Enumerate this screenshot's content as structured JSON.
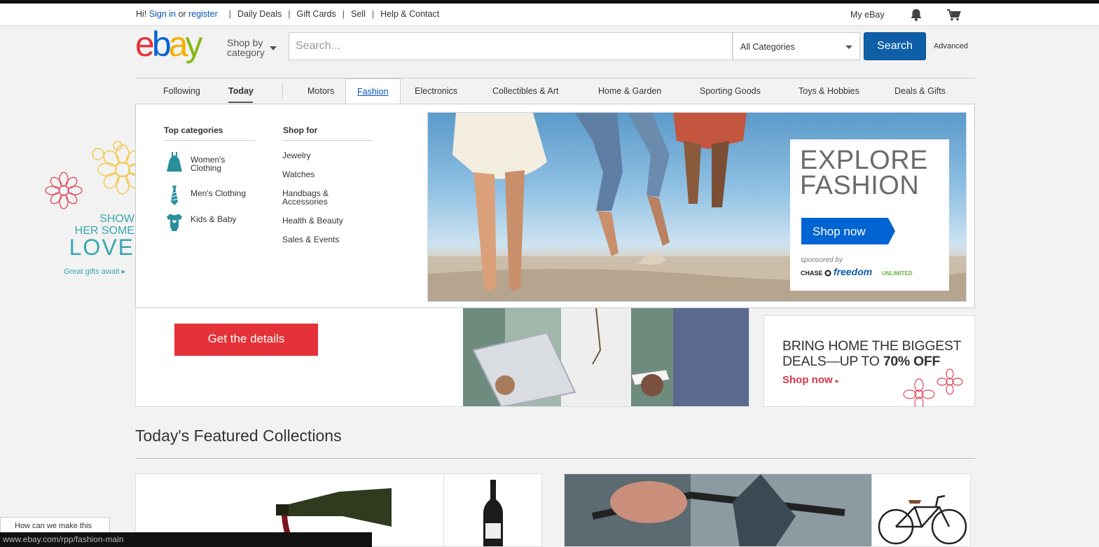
{
  "utility": {
    "greeting": "Hi!",
    "sign_in": "Sign in",
    "or": "or",
    "register": "register",
    "links": [
      "Daily Deals",
      "Gift Cards",
      "Sell",
      "Help & Contact"
    ],
    "my_ebay": "My eBay"
  },
  "header": {
    "shop_by_line1": "Shop by",
    "shop_by_line2": "category",
    "search_placeholder": "Search...",
    "category_selected": "All Categories",
    "search_button": "Search",
    "advanced": "Advanced"
  },
  "nav": {
    "items": [
      "Following",
      "Today",
      "Motors",
      "Fashion",
      "Electronics",
      "Collectibles & Art",
      "Home & Garden",
      "Sporting Goods",
      "Toys & Hobbies",
      "Deals & Gifts"
    ]
  },
  "dropdown": {
    "top_categories_heading": "Top categories",
    "top_categories": [
      {
        "line1": "Women's",
        "line2": "Clothing",
        "icon": "dress-icon"
      },
      {
        "line1": "Men's Clothing",
        "line2": "",
        "icon": "tie-icon"
      },
      {
        "line1": "Kids & Baby",
        "line2": "",
        "icon": "onesie-icon"
      }
    ],
    "shop_for_heading": "Shop for",
    "shop_for": [
      {
        "line1": "Jewelry",
        "line2": ""
      },
      {
        "line1": "Watches",
        "line2": ""
      },
      {
        "line1": "Handbags &",
        "line2": "Accessories"
      },
      {
        "line1": "Health & Beauty",
        "line2": ""
      },
      {
        "line1": "Sales & Events",
        "line2": ""
      }
    ],
    "banner": {
      "title_line1": "EXPLORE",
      "title_line2": "FASHION",
      "button": "Shop now",
      "sponsored": "sponsored by",
      "chase": "CHASE",
      "freedom": "freedom",
      "unlimited": "UNLIMITED"
    }
  },
  "left_promo": {
    "line1": "SHOW",
    "line2": "HER SOME",
    "line3": "LOVE",
    "link": "Great gifts await"
  },
  "promo": {
    "details_button": "Get the details"
  },
  "deals": {
    "line1": "BRING HOME THE BIGGEST",
    "line2_prefix": "DEALS—UP TO",
    "line2_bold": "70% OFF",
    "shop_now": "Shop now"
  },
  "featured": {
    "title": "Today's Featured Collections"
  },
  "footer": {
    "feedback": "How can we make this",
    "status_url": "www.ebay.com/rpp/fashion-main"
  },
  "colors": {
    "ebay_red": "#e53238",
    "ebay_blue": "#0064d2",
    "ebay_yellow": "#f5af02",
    "ebay_green": "#86b817",
    "search_button": "#0e5ea8",
    "love_teal": "#3aa7b0"
  }
}
